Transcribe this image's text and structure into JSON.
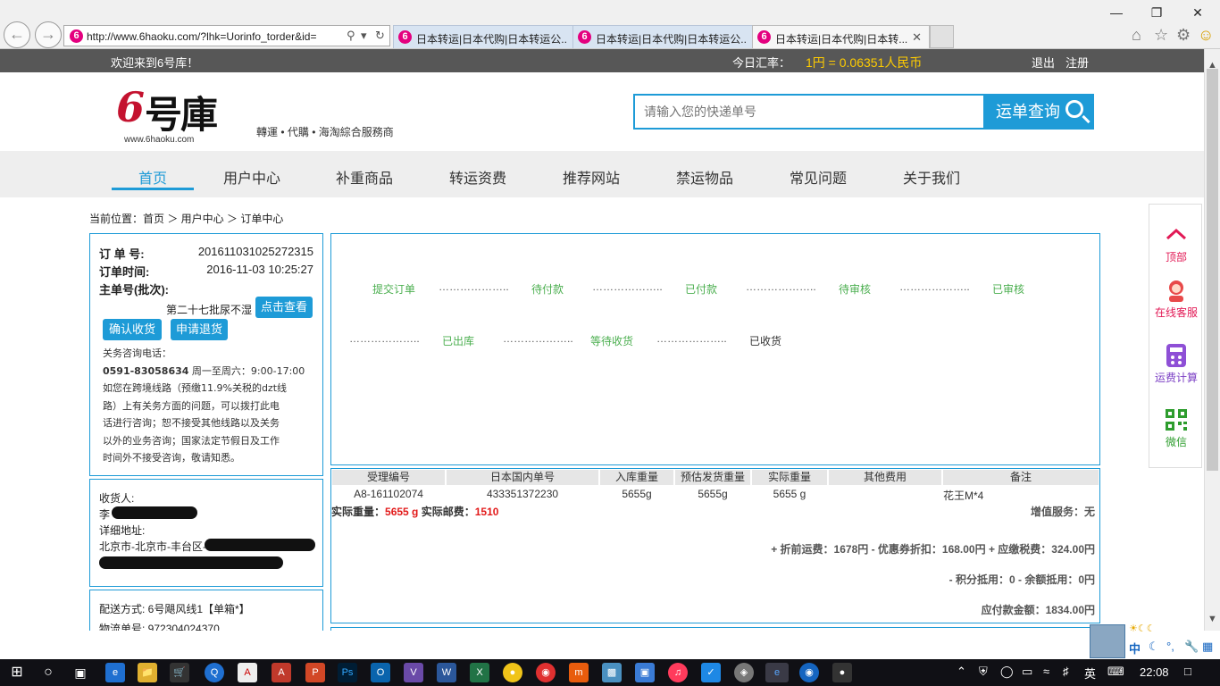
{
  "browser": {
    "url": "http://www.6haoku.com/?lhk=Uorinfo_torder&id=",
    "tabs": [
      {
        "title": "日本转运|日本代购|日本转运公..."
      },
      {
        "title": "日本转运|日本代购|日本转运公..."
      },
      {
        "title": "日本转运|日本代购|日本转..."
      }
    ],
    "site_icon_glyph": "6"
  },
  "topbar": {
    "welcome": "欢迎来到6号库！",
    "rate_label": "今日汇率：",
    "rate_value": "1円 = 0.06351人民币",
    "logout": "退出",
    "register": "注册"
  },
  "header": {
    "logo_text": "号庫",
    "logo_six": "6",
    "logo_site": "www.6haoku.com",
    "slogan": "轉運 • 代購 • 海淘綜合服務商",
    "search_placeholder": "请输入您的快递单号",
    "search_button": "运单查询"
  },
  "nav": {
    "items": [
      "首页",
      "用户中心",
      "补重商品",
      "转运资费",
      "推荐网站",
      "禁运物品",
      "常见问题",
      "关于我们"
    ]
  },
  "breadcrumb": "当前位置：首页 ＞ 用户中心 ＞ 订单中心",
  "order": {
    "order_no_label": "订 单 号:",
    "order_no": "201611031025272315",
    "order_time_label": "订单时间:",
    "order_time": "2016-11-03 10:25:27",
    "master_label": "主单号(批次):",
    "batch": "第二十七批尿不湿",
    "view_button": "点击查看",
    "confirm_button": "确认收货",
    "refund_button": "申请退货",
    "note_lines": [
      "关务咨询电话：",
      "0591-83058634 周一至周六：9:00-17:00",
      "如您在跨境线路（预缴11.9%关税的dzt线",
      "路）上有关务方面的问题，可以拨打此电",
      "话进行咨询；恕不接受其他线路以及关务",
      "以外的业务咨询；国家法定节假日及工作",
      "时间外不接受咨询，敬请知悉。"
    ],
    "note_phone": "0591-83058634",
    "note_hours": " 周一至周六：9:00-17:00"
  },
  "receiver": {
    "label": "收货人:",
    "name": "李",
    "address_label": "详细地址:",
    "address_line1": "北京市-北京市-丰台区-",
    "address_line2": ""
  },
  "shipping": {
    "method": "配送方式: 6号飓风线1【单箱*】",
    "tracking": "物流单号: 972304024370"
  },
  "progress": {
    "steps_row1": [
      "提交订单",
      "待付款",
      "已付款",
      "待审核",
      "已审核"
    ],
    "steps_row2": [
      "已出库",
      "等待收货",
      "已收货"
    ],
    "dots": "……………….."
  },
  "detail": {
    "headers": [
      "受理编号",
      "日本国内单号",
      "入库重量",
      "预估发货重量",
      "实际重量",
      "其他费用",
      "备注"
    ],
    "row": [
      "A8-161102074",
      "433351372230",
      "5655g",
      "5655g",
      "5655 g",
      "",
      "花王M*4"
    ],
    "actual_weight_label": "实际重量：",
    "actual_weight": "5655 g",
    "actual_postage_label": "实际邮费：",
    "actual_postage": "1510",
    "value_added": "增值服务：无",
    "fees_line": "+ 折前运费：1678円 - 优惠券折扣：168.00円 + 应缴税费：324.00円",
    "points_line": "- 积分抵用：0 - 余额抵用：0円",
    "total_line": "应付款金额：1834.00円"
  },
  "float_bar": {
    "items": [
      "顶部",
      "在线客服",
      "运费计算",
      "微信"
    ]
  },
  "ime": {
    "label": "中",
    "mode": "英"
  },
  "taskbar": {
    "time": "22:08"
  },
  "colors": {
    "accent": "#1e9bd7",
    "topbar_bg": "#575757",
    "rate_yellow": "#ffcc00",
    "step_green": "#4caf50",
    "red": "#e21a1a",
    "magenta": "#d2185a"
  }
}
